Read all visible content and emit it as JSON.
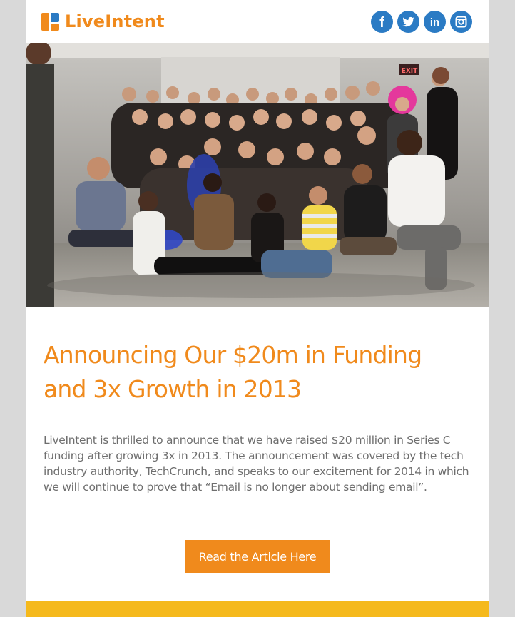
{
  "brand": {
    "name": "LiveIntent",
    "accent_color": "#f08a1c",
    "social_color": "#2b7bc4",
    "footer_color": "#f5b91c"
  },
  "social_links": [
    {
      "name": "facebook",
      "glyph": "f"
    },
    {
      "name": "twitter",
      "glyph": "bird"
    },
    {
      "name": "linkedin",
      "glyph": "in"
    },
    {
      "name": "instagram",
      "glyph": "camera"
    }
  ],
  "hero": {
    "exit_sign": "EXIT"
  },
  "article": {
    "headline_line1": "Announcing Our $20m in Funding",
    "headline_line2": "and 3x Growth in 2013",
    "body": "LiveIntent is thrilled to announce that we have raised $20 million in Series C funding after growing 3x in 2013. The announcement was covered by the tech industry authority, TechCrunch, and speaks to our excitement for 2014 in which we will continue to prove that “Email is no longer about sending email”."
  },
  "cta": {
    "label": "Read the Article Here"
  }
}
